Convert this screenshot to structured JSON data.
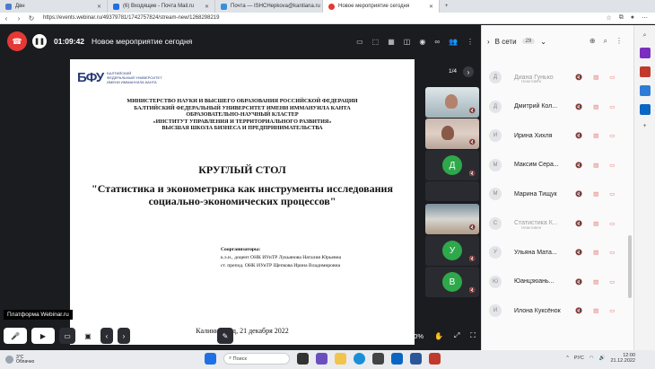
{
  "browser": {
    "tabs": [
      {
        "label": "Двн",
        "fav": "#4a7bd0"
      },
      {
        "label": "(6) Входящие - Почта Mail.ru",
        "fav": "#1f6fe5"
      },
      {
        "label": "Почта — ISHCHepkova@kantiana.ru",
        "fav": "#3a8fd8"
      },
      {
        "label": "Новое мероприятие сегодня",
        "fav": "#e53935"
      }
    ],
    "url": "https://events.webinar.ru/49379781/1742757824/stream-new/1268298219"
  },
  "app": {
    "timer": "01:09:42",
    "event_title": "Новое мероприятие сегодня",
    "page_indicator": "1/4",
    "tooltip": "Платформа Webinar.ru",
    "zoom": "80%"
  },
  "slide": {
    "logo_mark": "БФУ",
    "logo_text": [
      "БАЛТИЙСКИЙ",
      "ФЕДЕРАЛЬНЫЙ УНИВЕРСИТЕТ",
      "ИМЕНИ ИММАНУИЛА КАНТА"
    ],
    "header": [
      "МИНИСТЕРСТВО НАУКИ И ВЫСШЕГО ОБРАЗОВАНИЯ РОССИЙСКОЙ ФЕДЕРАЦИИ",
      "БАЛТИЙСКИЙ ФЕДЕРАЛЬНЫЙ УНИВЕРСИТЕТ ИМЕНИ ИММАНУИЛА КАНТА",
      "ОБРАЗОВАТЕЛЬНО-НАУЧНЫЙ КЛАСТЕР",
      "«ИНСТИТУТ УПРАВЛЕНИЯ И ТЕРРИТОРИАЛЬНОГО РАЗВИТИЯ»",
      "ВЫСШАЯ ШКОЛА БИЗНЕСА И ПРЕДПРИНИМАТЕЛЬСТВА"
    ],
    "kind": "КРУГЛЫЙ СТОЛ",
    "topic": "\"Статистика и эконометрика как инструменты исследования социально-экономических процессов\"",
    "orgs_title": "Соорганизаторы:",
    "org1": "к.э.н., доцент ОНК ИУиТР Лукьянова Наталия Юрьевна",
    "org2": "ст. препод. ОНК ИУиТР Щепкова Ирина Владимировна",
    "city_date": "Калининград, 21 декабря 2022"
  },
  "video": {
    "guests": [
      {
        "initial": "Д"
      },
      {
        "initial": "У"
      },
      {
        "initial": "В"
      }
    ]
  },
  "sidebar": {
    "title": "В сети",
    "count": "29",
    "people": [
      {
        "initial": "Д",
        "name": "Диана Гунько",
        "sub": "Неактивен",
        "dim": true
      },
      {
        "initial": "Д",
        "name": "Дмитрий Кол...",
        "sub": "",
        "dim": false
      },
      {
        "initial": "И",
        "name": "Ирина Хихля",
        "sub": "",
        "dim": false
      },
      {
        "initial": "М",
        "name": "Максим Серa...",
        "sub": "",
        "dim": false
      },
      {
        "initial": "М",
        "name": "Марина Тищук",
        "sub": "",
        "dim": false
      },
      {
        "initial": "С",
        "name": "Статистика К...",
        "sub": "Неактивен",
        "dim": true
      },
      {
        "initial": "У",
        "name": "Ульяна Мата...",
        "sub": "",
        "dim": false
      },
      {
        "initial": "Ю",
        "name": "Юанцзюань...",
        "sub": "",
        "dim": false
      },
      {
        "initial": "И",
        "name": "Илона Куксёнок",
        "sub": "",
        "dim": false
      }
    ]
  },
  "taskbar": {
    "temp": "3°C",
    "weather": "Облачно",
    "search": "Поиск",
    "lang": "РУС",
    "time": "12:00",
    "date": "21.12.2022"
  }
}
